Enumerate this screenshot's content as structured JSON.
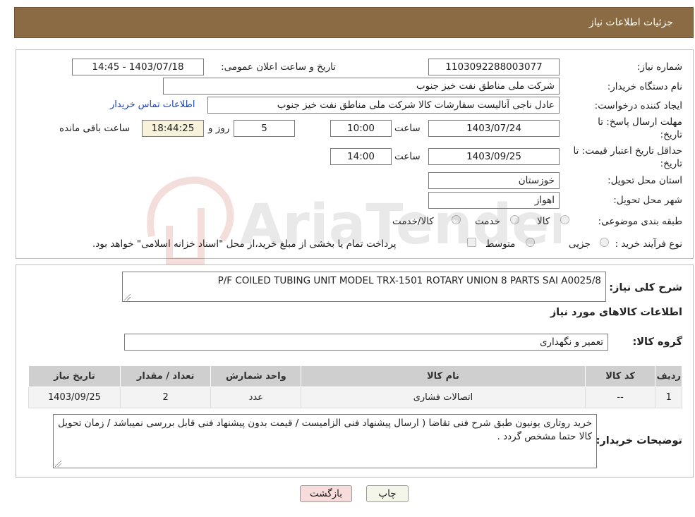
{
  "header": {
    "title": "جزئیات اطلاعات نیاز"
  },
  "form": {
    "need_number_label": "شماره نیاز:",
    "need_number": "1103092288003077",
    "announce_label": "تاریخ و ساعت اعلان عمومی:",
    "announce_value": "1403/07/18 - 14:45",
    "buyer_org_label": "نام دستگاه خریدار:",
    "buyer_org": "شرکت ملی مناطق نفت خیز جنوب",
    "creator_label": "ایجاد کننده درخواست:",
    "creator": "عادل  ناجی آنالیست سفارشات کالا  شرکت ملی مناطق نفت خیز جنوب",
    "contact_link": "اطلاعات تماس خریدار",
    "deadline_label": "مهلت ارسال پاسخ: تا تاریخ:",
    "deadline_date": "1403/07/24",
    "time_label": "ساعت",
    "deadline_time": "10:00",
    "days_value": "5",
    "days_label": "روز و",
    "remaining_time": "18:44:25",
    "remaining_label": "ساعت باقی مانده",
    "validity_label": "حداقل تاریخ اعتبار قیمت: تا تاریخ:",
    "validity_date": "1403/09/25",
    "validity_time": "14:00",
    "province_label": "استان محل تحویل:",
    "province": "خوزستان",
    "city_label": "شهر محل تحویل:",
    "city": "اهواز",
    "category_label": "طبقه بندی موضوعی:",
    "category_options": [
      "کالا",
      "خدمت",
      "کالا/خدمت"
    ],
    "process_label": "نوع فرآیند خرید :",
    "process_options": [
      "جزیی",
      "متوسط"
    ],
    "process_note": "پرداخت تمام یا بخشی از مبلغ خرید،از محل \"اسناد خزانه اسلامی\" خواهد بود."
  },
  "details": {
    "description_label": "شرح کلی نیاز:",
    "description": "P/F COILED TUBING UNIT MODEL TRX-1501 ROTARY UNION 8 PARTS SAI A0025/8",
    "goods_info_title": "اطلاعات کالاهای مورد نیاز",
    "goods_group_label": "گروه کالا:",
    "goods_group": "تعمیر و نگهداری",
    "table": {
      "headers": [
        "ردیف",
        "کد کالا",
        "نام کالا",
        "واحد شمارش",
        "تعداد / مقدار",
        "تاریخ نیاز"
      ],
      "rows": [
        [
          "1",
          "--",
          "اتصالات فشاری",
          "عدد",
          "2",
          "1403/09/25"
        ]
      ]
    },
    "buyer_notes_label": "توضیحات خریدار:",
    "buyer_notes": "خرید روتاری یونیون طبق شرح فنی تقاضا ( ارسال پیشنهاد فنی الزامیست / قیمت بدون پیشنهاد فنی قابل بررسی نمیباشد / زمان تحویل کالا حتما مشخص گردد ."
  },
  "buttons": {
    "print": "چاپ",
    "back": "بازگشت"
  },
  "watermark_text": "AriaTender.neT",
  "colors": {
    "header_bg": "#8b6b44",
    "link": "#1a44b8",
    "time_bg": "#f6f3da",
    "back_btn_bg": "#f8dcdc"
  }
}
